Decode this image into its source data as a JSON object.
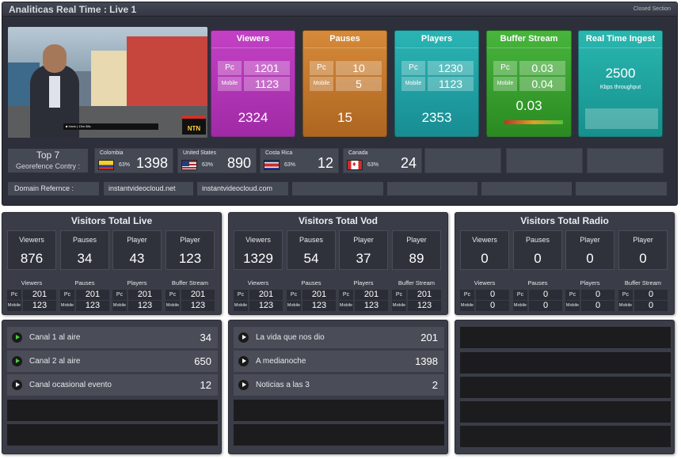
{
  "app": {
    "title": "Analiticas Real Time : Live 1",
    "closed_section": "Closed Section"
  },
  "video": {
    "lower_third": "■ Inicio | 13m 38s",
    "logo": "NTN"
  },
  "metrics": {
    "viewers": {
      "title": "Viewers",
      "pc_label": "Pc",
      "mobile_label": "Mobile",
      "pc": "1201",
      "mobile": "1123",
      "total": "2324"
    },
    "pauses": {
      "title": "Pauses",
      "pc_label": "Pc",
      "mobile_label": "Mobile",
      "pc": "10",
      "mobile": "5",
      "total": "15"
    },
    "players": {
      "title": "Players",
      "pc_label": "Pc",
      "mobile_label": "Mobile",
      "pc": "1230",
      "mobile": "1123",
      "total": "2353"
    },
    "buffer": {
      "title": "Buffer Stream",
      "pc_label": "Pc",
      "mobile_label": "Mobile",
      "pc": "0.03",
      "mobile": "0.04",
      "total": "0.03"
    },
    "ingest": {
      "title": "Real Time Ingest",
      "value": "2500",
      "unit": "Kbps throughput"
    }
  },
  "georeference": {
    "line1": "Top  7",
    "line2": "Georefence Contry :",
    "countries": [
      {
        "name": "Colombia",
        "pct": "63%",
        "value": "1398"
      },
      {
        "name": "United States",
        "pct": "63%",
        "value": "890"
      },
      {
        "name": "Costa Rica",
        "pct": "63%",
        "value": "12"
      },
      {
        "name": "Canada",
        "pct": "63%",
        "value": "24"
      }
    ]
  },
  "domains": {
    "label": "Domain Refernce :",
    "items": [
      "instantvideocloud.net",
      "instantvideocloud.com"
    ]
  },
  "visitors": [
    {
      "title": "Visitors Total Live",
      "boxes": [
        {
          "label": "Viewers",
          "value": "876"
        },
        {
          "label": "Pauses",
          "value": "34"
        },
        {
          "label": "Player",
          "value": "43"
        },
        {
          "label": "Player",
          "value": "123"
        }
      ],
      "subs": [
        {
          "label": "Viewers",
          "pc": "201",
          "mobile": "123"
        },
        {
          "label": "Pauses",
          "pc": "201",
          "mobile": "123"
        },
        {
          "label": "Players",
          "pc": "201",
          "mobile": "123"
        },
        {
          "label": "Buffer Stream",
          "pc": "201",
          "mobile": "123"
        }
      ]
    },
    {
      "title": "Visitors Total Vod",
      "boxes": [
        {
          "label": "Viewers",
          "value": "1329"
        },
        {
          "label": "Pauses",
          "value": "54"
        },
        {
          "label": "Player",
          "value": "37"
        },
        {
          "label": "Player",
          "value": "89"
        }
      ],
      "subs": [
        {
          "label": "Viewers",
          "pc": "201",
          "mobile": "123"
        },
        {
          "label": "Pauses",
          "pc": "201",
          "mobile": "123"
        },
        {
          "label": "Players",
          "pc": "201",
          "mobile": "123"
        },
        {
          "label": "Buffer Stream",
          "pc": "201",
          "mobile": "123"
        }
      ]
    },
    {
      "title": "Visitors Total Radio",
      "boxes": [
        {
          "label": "Viewers",
          "value": "0"
        },
        {
          "label": "Pauses",
          "value": "0"
        },
        {
          "label": "Player",
          "value": "0"
        },
        {
          "label": "Player",
          "value": "0"
        }
      ],
      "subs": [
        {
          "label": "Viewers",
          "pc": "0",
          "mobile": "0"
        },
        {
          "label": "Pauses",
          "pc": "0",
          "mobile": "0"
        },
        {
          "label": "Players",
          "pc": "0",
          "mobile": "0"
        },
        {
          "label": "Buffer Stream",
          "pc": "0",
          "mobile": "0"
        }
      ]
    }
  ],
  "sub_labels": {
    "pc": "Pc",
    "mobile": "Mobile"
  },
  "channels_live": [
    {
      "name": "Canal 1 al aire",
      "value": "34",
      "icon": "play-icon",
      "active": true
    },
    {
      "name": "Canal 2 al aire",
      "value": "650",
      "icon": "play-icon",
      "active": true
    },
    {
      "name": "Canal ocasional evento",
      "value": "12",
      "icon": "play-icon",
      "active": false
    }
  ],
  "channels_vod": [
    {
      "name": "La vida que nos dio",
      "value": "201",
      "icon": "play-icon",
      "active": false
    },
    {
      "name": "A medianoche",
      "value": "1398",
      "icon": "play-icon",
      "active": false
    },
    {
      "name": "Noticias a las 3",
      "value": "2",
      "icon": "play-icon",
      "active": false
    }
  ],
  "colors": {
    "viewers": "#b335b6",
    "pauses": "#c2782d",
    "players": "#22a3a6",
    "buffer": "#3aa22f",
    "ingest": "#20a5a0",
    "panel": "#3a3d47"
  }
}
